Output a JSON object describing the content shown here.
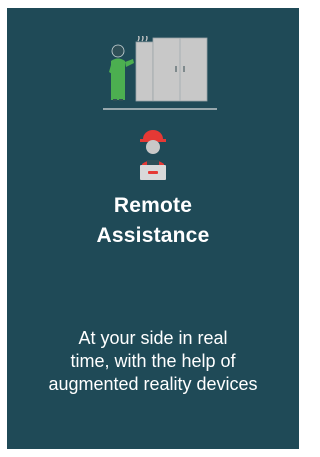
{
  "card": {
    "title_lines": [
      "Remote",
      "Assistance"
    ],
    "description_lines": [
      "At your side in real",
      "time, with the help of",
      "augmented reality devices"
    ],
    "illustration": {
      "top_icon": "technician-with-machine-icon",
      "bottom_icon": "remote-technician-laptop-icon"
    }
  },
  "colors": {
    "card_background": "#1f4a57",
    "text": "#ffffff",
    "machine": "#c8c8c8",
    "technician_green": "#4caf50",
    "helmet_red": "#e53935"
  }
}
